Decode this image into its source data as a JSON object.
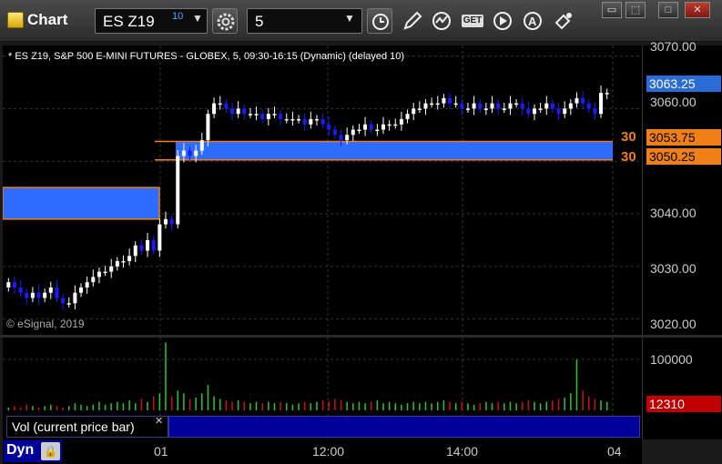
{
  "toolbar": {
    "app_title": "Chart",
    "symbol": "ES Z19",
    "symbol_badge": "10",
    "interval": "5",
    "get_label": "GET",
    "window_buttons": [
      "▭",
      "⬚",
      "□",
      "✕"
    ]
  },
  "chart": {
    "title": "* ES Z19, S&P 500 E-MINI FUTURES - GLOBEX, 5, 09:30-16:15 (Dynamic) (delayed 10)",
    "copyright": "© eSignal, 2019",
    "price_axis_labels": [
      "3070.00",
      "3060.00",
      "3040.00",
      "3030.00",
      "3020.00"
    ],
    "current_price": "3063.25",
    "level_upper": "3053.75",
    "level_lower": "3050.25",
    "level_upper_short": "30",
    "level_lower_short": "30",
    "colors": {
      "up": "#ffffff",
      "down": "#1a1aff",
      "zone": "#2f6bff",
      "level": "#f07f16",
      "vol_up": "#28c828",
      "vol_down": "#d01010"
    }
  },
  "volume": {
    "axis_label": "100000",
    "current_volume": "12310",
    "study_label": "Vol (current price bar)",
    "study_close": "✕"
  },
  "time_axis": {
    "labels": [
      "01",
      "12:00",
      "14:00",
      "04"
    ]
  },
  "status": {
    "mode": "Dyn",
    "lock_icon": "🔒"
  },
  "chart_data": {
    "type": "candlestick",
    "title": "* ES Z19, S&P 500 E-MINI FUTURES - GLOBEX, 5, 09:30-16:15 (Dynamic) (delayed 10)",
    "ylim": [
      3017,
      3072
    ],
    "price_levels": {
      "current": 3063.25,
      "upper": 3053.75,
      "lower": 3050.25
    },
    "prior_zone": [
      3039,
      3045
    ],
    "close_series": [
      3027,
      3026,
      3025,
      3024,
      3025,
      3024,
      3025,
      3026,
      3024,
      3023,
      3023,
      3025,
      3026,
      3027,
      3028,
      3029,
      3029,
      3030,
      3031,
      3031,
      3032,
      3034,
      3033,
      3035,
      3033,
      3038,
      3039,
      3038,
      3051,
      3052,
      3051,
      3052,
      3054,
      3059,
      3061,
      3061,
      3060,
      3059,
      3060,
      3059,
      3059,
      3059,
      3058,
      3059,
      3059,
      3058,
      3058,
      3058,
      3058,
      3057,
      3058,
      3058,
      3057,
      3056,
      3055,
      3054,
      3055,
      3056,
      3056,
      3057,
      3056,
      3056,
      3057,
      3057,
      3057,
      3058,
      3059,
      3060,
      3060,
      3061,
      3061,
      3061,
      3062,
      3061,
      3061,
      3060,
      3060,
      3061,
      3060,
      3060,
      3061,
      3060,
      3060,
      3061,
      3061,
      3060,
      3059,
      3060,
      3060,
      3061,
      3060,
      3059,
      3060,
      3061,
      3062,
      3061,
      3060,
      3059,
      3063,
      3063
    ],
    "volume_series": [
      2,
      3,
      2,
      4,
      3,
      2,
      3,
      4,
      3,
      2,
      3,
      5,
      4,
      3,
      4,
      6,
      4,
      5,
      6,
      5,
      7,
      5,
      8,
      6,
      10,
      12,
      48,
      10,
      14,
      12,
      8,
      9,
      12,
      18,
      10,
      8,
      7,
      6,
      7,
      6,
      5,
      6,
      5,
      6,
      5,
      6,
      5,
      4,
      5,
      6,
      5,
      6,
      7,
      6,
      8,
      7,
      6,
      5,
      6,
      5,
      6,
      7,
      5,
      6,
      5,
      4,
      5,
      6,
      5,
      6,
      5,
      6,
      7,
      6,
      5,
      6,
      5,
      4,
      5,
      6,
      5,
      6,
      5,
      6,
      5,
      6,
      7,
      6,
      5,
      6,
      7,
      8,
      9,
      12,
      36,
      14,
      10,
      8,
      7,
      6
    ],
    "volume_ylim": [
      0,
      110000
    ]
  }
}
